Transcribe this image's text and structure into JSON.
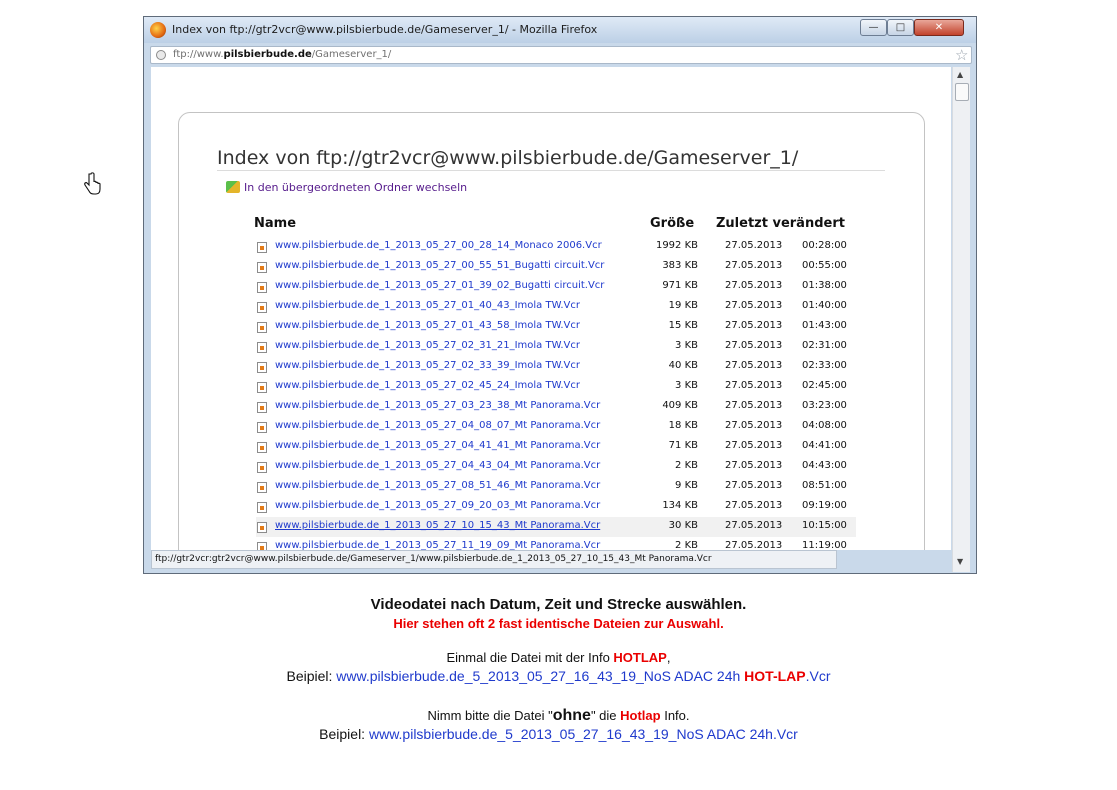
{
  "window": {
    "title": "Index von ftp://gtr2vcr@www.pilsbierbude.de/Gameserver_1/ - Mozilla Firefox",
    "url_prefix": "ftp://www.",
    "url_host": "pilsbierbude.de",
    "url_path": "/Gameserver_1/",
    "buttons": {
      "minimize": "—",
      "maximize": "□",
      "close": "✕"
    }
  },
  "listing": {
    "heading": "Index von ftp://gtr2vcr@www.pilsbierbude.de/Gameserver_1/",
    "parent_link": "In den übergeordneten Ordner wechseln",
    "columns": {
      "name": "Name",
      "size": "Größe",
      "modified": "Zuletzt verändert"
    },
    "files": [
      {
        "name": "www.pilsbierbude.de_1_2013_05_27_00_28_14_Monaco 2006.Vcr",
        "size": "1992 KB",
        "date": "27.05.2013",
        "time": "00:28:00"
      },
      {
        "name": "www.pilsbierbude.de_1_2013_05_27_00_55_51_Bugatti circuit.Vcr",
        "size": "383 KB",
        "date": "27.05.2013",
        "time": "00:55:00"
      },
      {
        "name": "www.pilsbierbude.de_1_2013_05_27_01_39_02_Bugatti circuit.Vcr",
        "size": "971 KB",
        "date": "27.05.2013",
        "time": "01:38:00"
      },
      {
        "name": "www.pilsbierbude.de_1_2013_05_27_01_40_43_Imola TW.Vcr",
        "size": "19 KB",
        "date": "27.05.2013",
        "time": "01:40:00"
      },
      {
        "name": "www.pilsbierbude.de_1_2013_05_27_01_43_58_Imola TW.Vcr",
        "size": "15 KB",
        "date": "27.05.2013",
        "time": "01:43:00"
      },
      {
        "name": "www.pilsbierbude.de_1_2013_05_27_02_31_21_Imola TW.Vcr",
        "size": "3 KB",
        "date": "27.05.2013",
        "time": "02:31:00"
      },
      {
        "name": "www.pilsbierbude.de_1_2013_05_27_02_33_39_Imola TW.Vcr",
        "size": "40 KB",
        "date": "27.05.2013",
        "time": "02:33:00"
      },
      {
        "name": "www.pilsbierbude.de_1_2013_05_27_02_45_24_Imola TW.Vcr",
        "size": "3 KB",
        "date": "27.05.2013",
        "time": "02:45:00"
      },
      {
        "name": "www.pilsbierbude.de_1_2013_05_27_03_23_38_Mt Panorama.Vcr",
        "size": "409 KB",
        "date": "27.05.2013",
        "time": "03:23:00"
      },
      {
        "name": "www.pilsbierbude.de_1_2013_05_27_04_08_07_Mt Panorama.Vcr",
        "size": "18 KB",
        "date": "27.05.2013",
        "time": "04:08:00"
      },
      {
        "name": "www.pilsbierbude.de_1_2013_05_27_04_41_41_Mt Panorama.Vcr",
        "size": "71 KB",
        "date": "27.05.2013",
        "time": "04:41:00"
      },
      {
        "name": "www.pilsbierbude.de_1_2013_05_27_04_43_04_Mt Panorama.Vcr",
        "size": "2 KB",
        "date": "27.05.2013",
        "time": "04:43:00"
      },
      {
        "name": "www.pilsbierbude.de_1_2013_05_27_08_51_46_Mt Panorama.Vcr",
        "size": "9 KB",
        "date": "27.05.2013",
        "time": "08:51:00"
      },
      {
        "name": "www.pilsbierbude.de_1_2013_05_27_09_20_03_Mt Panorama.Vcr",
        "size": "134 KB",
        "date": "27.05.2013",
        "time": "09:19:00"
      },
      {
        "name": "www.pilsbierbude.de_1_2013_05_27_10_15_43_Mt Panorama.Vcr",
        "size": "30 KB",
        "date": "27.05.2013",
        "time": "10:15:00"
      },
      {
        "name": "www.pilsbierbude.de_1_2013_05_27_11_19_09_Mt Panorama.Vcr",
        "size": "2 KB",
        "date": "27.05.2013",
        "time": "11:19:00"
      }
    ],
    "hovered_index": 14
  },
  "statusbar": "ftp://gtr2vcr:gtr2vcr@www.pilsbierbude.de/Gameserver_1/www.pilsbierbude.de_1_2013_05_27_10_15_43_Mt Panorama.Vcr",
  "caption": {
    "line1": "Videodatei nach Datum, Zeit und Strecke auswählen.",
    "line2": "Hier stehen oft  2 fast identische Dateien zur Auswahl.",
    "einmal_pre": "Einmal die Datei mit der Info ",
    "einmal_hot": "HOTLAP",
    "einmal_post": ",",
    "beispiel1_label": "Beipiel: ",
    "beispiel1_file": "www.pilsbierbude.de_5_2013_05_27_16_43_19_NoS ADAC 24h ",
    "beispiel1_hot": "HOT-LAP",
    "beispiel1_ext": ".Vcr",
    "nimm_pre": "Nimm bitte die Datei  \"",
    "nimm_ohne": "ohne",
    "nimm_mid": "\" die ",
    "nimm_hot": "Hotlap",
    "nimm_post": " Info.",
    "beispiel2_label": "Beipiel: ",
    "beispiel2_file": "www.pilsbierbude.de_5_2013_05_27_16_43_19_NoS ADAC 24h.Vcr"
  }
}
